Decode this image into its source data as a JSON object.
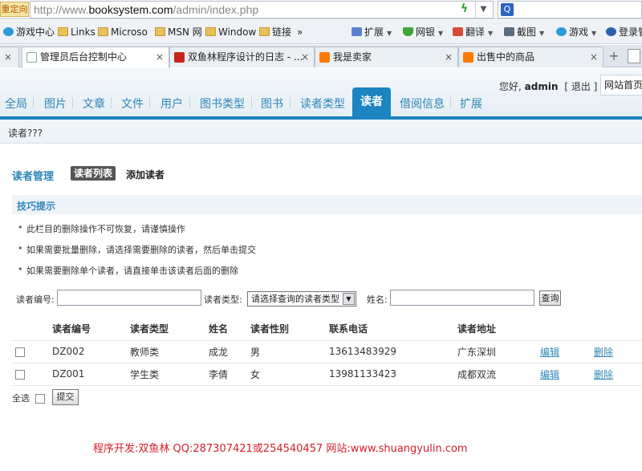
{
  "browser": {
    "redirect_label": "重定向",
    "url_prefix": "http://www.",
    "url_domain": "booksystem.com",
    "url_path": "/admin/index.php",
    "bookmarks": [
      {
        "label": "游戏中心",
        "icon": "game-icon"
      },
      {
        "label": "Links",
        "icon": "folder-icon"
      },
      {
        "label": "Microso",
        "icon": "folder-icon"
      },
      {
        "label": "MSN 网",
        "icon": "folder-icon"
      },
      {
        "label": "Window",
        "icon": "folder-icon"
      },
      {
        "label": "链接",
        "icon": "folder-icon"
      },
      {
        "label": "»",
        "icon": ""
      }
    ],
    "toolbar": [
      {
        "label": "扩展",
        "icon": "ext-icon"
      },
      {
        "label": "网银",
        "icon": "shield-icon"
      },
      {
        "label": "翻译",
        "icon": "translate-icon"
      },
      {
        "label": "截图",
        "icon": "camera-icon"
      },
      {
        "label": "游戏",
        "icon": "game-icon"
      },
      {
        "label": "登录管",
        "icon": "key-icon"
      }
    ],
    "tabs": [
      {
        "label": "管理员后台控制中心",
        "active": true
      },
      {
        "label": "双鱼林程序设计的日志 - ...",
        "active": false
      },
      {
        "label": "我是卖家",
        "active": false
      },
      {
        "label": "出售中的商品",
        "active": false
      }
    ]
  },
  "header": {
    "greeting": "您好,",
    "username": "admin",
    "logout": "[ 退出 ]",
    "home_link": "网站首页"
  },
  "nav": {
    "items": [
      "全局",
      "图片",
      "文章",
      "文件",
      "用户",
      "图书类型",
      "图书",
      "读者类型"
    ],
    "active": "读者",
    "after": [
      "借阅信息",
      "扩展"
    ]
  },
  "breadcrumb": "读者???",
  "section": {
    "title": "读者管理",
    "tab_list": "读者列表",
    "tab_add": "添加读者"
  },
  "tips": {
    "title": "技巧提示",
    "items": [
      "此栏目的删除操作不可恢复，请谨慎操作",
      "如果需要批量删除，请选择需要删除的读者，然后单击提交",
      "如果需要删除单个读者，请直接单击该读者后面的删除"
    ]
  },
  "filter": {
    "reader_no_label": "读者编号:",
    "reader_no_value": "",
    "reader_type_label": "读者类型:",
    "reader_type_selected": "请选择查询的读者类型",
    "name_label": "姓名:",
    "name_value": "",
    "query_button": "查询"
  },
  "table": {
    "headers": [
      "读者编号",
      "读者类型",
      "姓名",
      "读者性别",
      "联系电话",
      "读者地址"
    ],
    "rows": [
      {
        "no": "DZ002",
        "type": "教师类",
        "name": "成龙",
        "gender": "男",
        "phone": "13613483929",
        "address": "广东深圳",
        "edit": "编辑",
        "delete": "删除"
      },
      {
        "no": "DZ001",
        "type": "学生类",
        "name": "李倩",
        "gender": "女",
        "phone": "13981133423",
        "address": "成都双流",
        "edit": "编辑",
        "delete": "删除"
      }
    ]
  },
  "bottom": {
    "select_all": "全选",
    "submit": "提交"
  },
  "footer": "程序开发:双鱼林 QQ:287307421或254540457 网站:www.shuangyulin.com"
}
